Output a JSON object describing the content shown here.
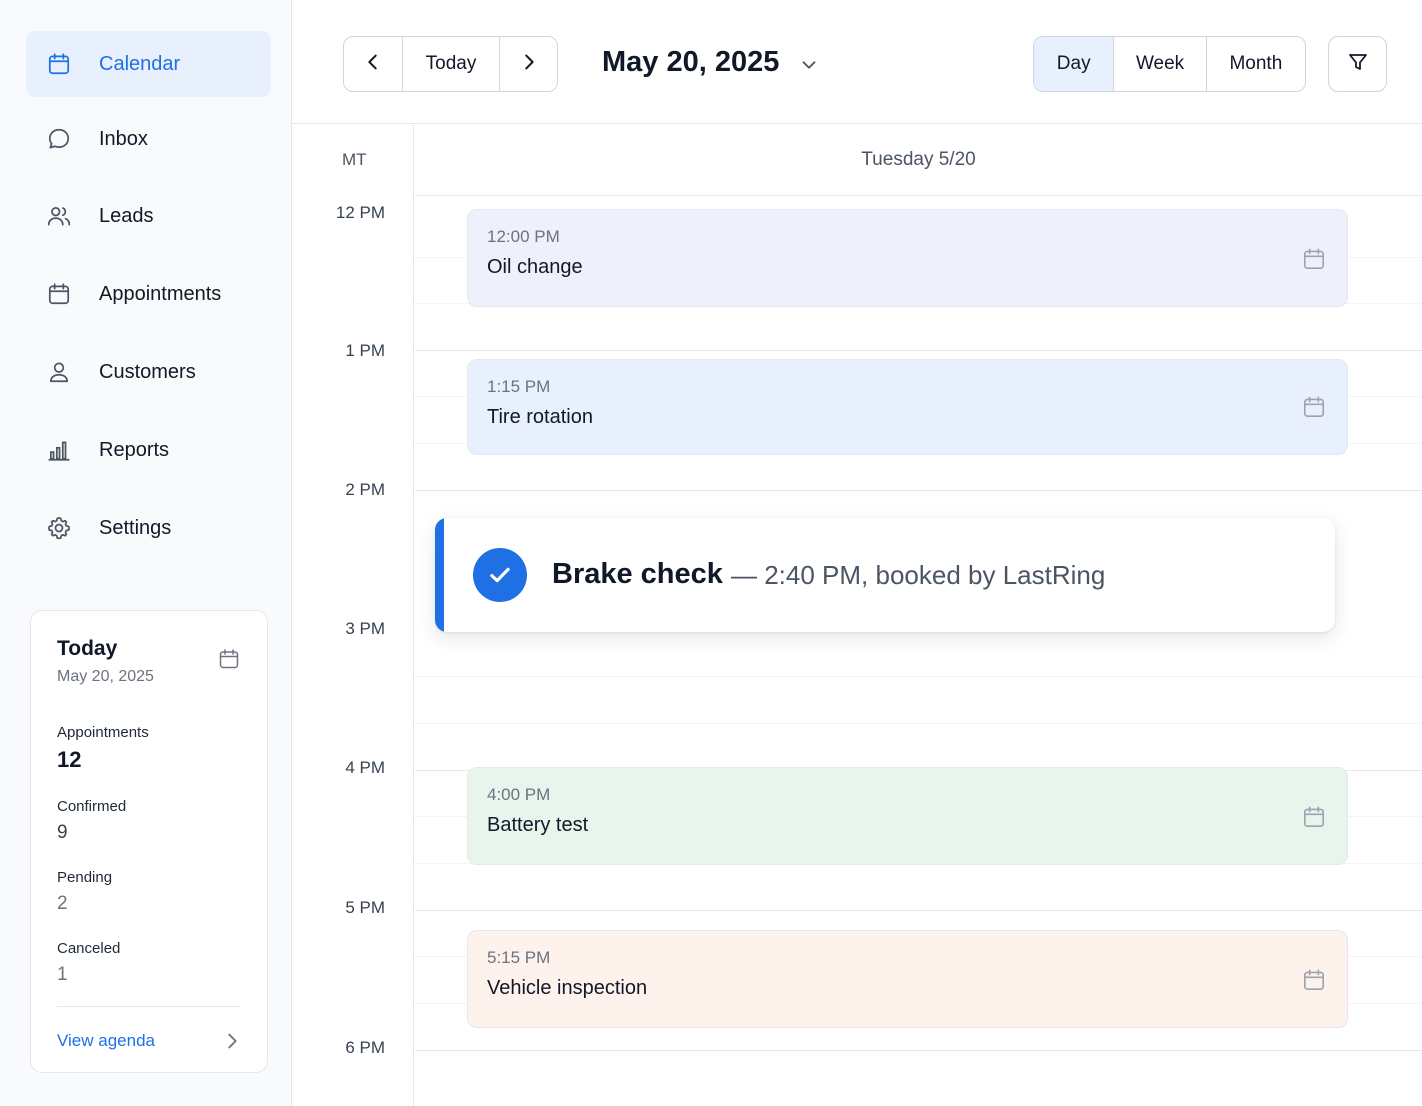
{
  "sidebar": {
    "items": [
      {
        "label": "Calendar",
        "icon": "calendar-icon",
        "active": true
      },
      {
        "label": "Inbox",
        "icon": "chat-bubble-icon"
      },
      {
        "label": "Leads",
        "icon": "users-icon"
      },
      {
        "label": "Appointments",
        "icon": "calendar-icon"
      },
      {
        "label": "Customers",
        "icon": "user-icon"
      },
      {
        "label": "Reports",
        "icon": "bar-chart-icon"
      },
      {
        "label": "Settings",
        "icon": "gear-icon"
      }
    ],
    "today_card": {
      "title": "Today",
      "date": "May 20, 2025",
      "stats": [
        {
          "label": "Appointments",
          "value": "12"
        },
        {
          "label": "Confirmed",
          "value": "9"
        },
        {
          "label": "Pending",
          "value": "2"
        },
        {
          "label": "Canceled",
          "value": "1"
        }
      ],
      "link": "View agenda"
    }
  },
  "header": {
    "today_label": "Today",
    "date_title": "May 20, 2025",
    "views": [
      "Day",
      "Week",
      "Month"
    ],
    "active_view": "Day"
  },
  "calendar": {
    "timezone": "MT",
    "day_label": "Tuesday 5/20",
    "hours": [
      "12 PM",
      "1 PM",
      "2 PM",
      "3 PM",
      "4 PM",
      "5 PM",
      "6 PM"
    ],
    "events": [
      {
        "time": "12:00 PM",
        "title": "Oil change",
        "color": "#eef1fb"
      },
      {
        "time": "1:15 PM",
        "title": "Tire rotation",
        "color": "#e8f0fd"
      },
      {
        "time": "4:00 PM",
        "title": "Battery test",
        "color": "#e7f5ec"
      },
      {
        "time": "5:15 PM",
        "title": "Vehicle inspection",
        "color": "#fdf3ec"
      }
    ]
  },
  "toast": {
    "title": "Brake check",
    "detail": "— 2:40 PM, booked by LastRing",
    "accent": "#1f6fe5"
  },
  "colors": {
    "accent": "#1f6fe5",
    "active_bg": "#e8f0fd"
  }
}
